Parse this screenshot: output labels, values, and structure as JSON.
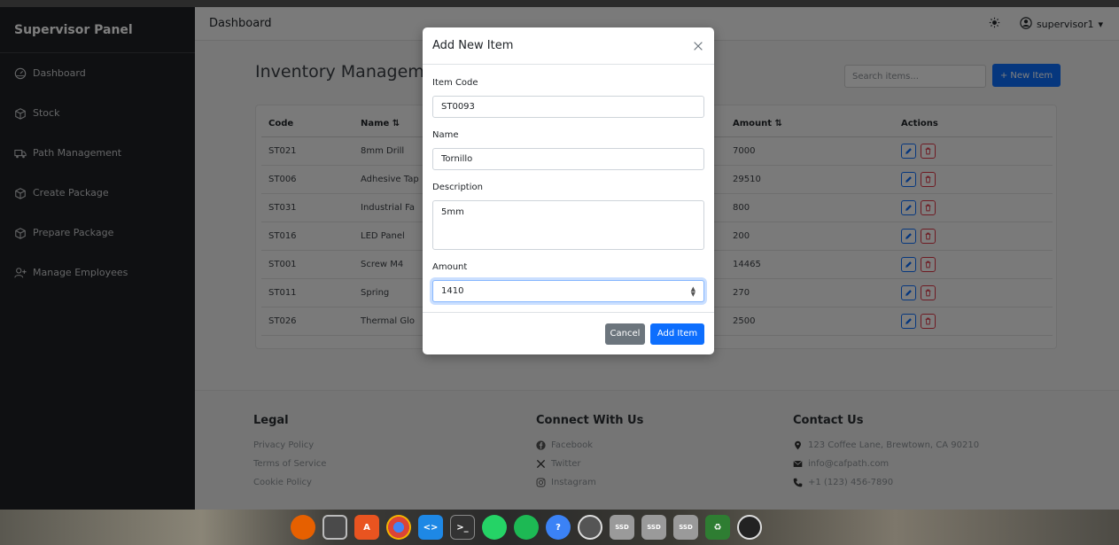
{
  "sidebar": {
    "title": "Supervisor Panel",
    "items": [
      {
        "label": "Dashboard",
        "icon": "speedometer-icon"
      },
      {
        "label": "Stock",
        "icon": "box-icon"
      },
      {
        "label": "Path Management",
        "icon": "truck-icon"
      },
      {
        "label": "Create Package",
        "icon": "box-icon"
      },
      {
        "label": "Prepare Package",
        "icon": "box-icon"
      },
      {
        "label": "Manage Employees",
        "icon": "user-plus-icon"
      }
    ]
  },
  "topbar": {
    "title": "Dashboard",
    "username": "supervisor1"
  },
  "page": {
    "title": "Inventory Managemen",
    "search_placeholder": "Search items...",
    "new_item_label": "+ New Item"
  },
  "table": {
    "headers": {
      "code": "Code",
      "name": "Name ⇅",
      "amount": "Amount ⇅",
      "actions": "Actions"
    },
    "rows": [
      {
        "code": "ST021",
        "name": "8mm Drill",
        "amount": "7000"
      },
      {
        "code": "ST006",
        "name": "Adhesive Tap",
        "amount": "29510"
      },
      {
        "code": "ST031",
        "name": "Industrial Fa",
        "amount": "800"
      },
      {
        "code": "ST016",
        "name": "LED Panel",
        "amount": "200"
      },
      {
        "code": "ST001",
        "name": "Screw M4",
        "amount": "14465"
      },
      {
        "code": "ST011",
        "name": "Spring",
        "amount": "270"
      },
      {
        "code": "ST026",
        "name": "Thermal Glo",
        "amount": "2500"
      }
    ]
  },
  "footer": {
    "legal": {
      "title": "Legal",
      "links": [
        "Privacy Policy",
        "Terms of Service",
        "Cookie Policy"
      ]
    },
    "connect": {
      "title": "Connect With Us",
      "links": [
        "Facebook",
        "Twitter",
        "Instagram"
      ]
    },
    "contact": {
      "title": "Contact Us",
      "address": "123 Coffee Lane, Brewtown, CA 90210",
      "email": "info@cafpath.com",
      "phone": "+1 (123) 456-7890"
    }
  },
  "modal": {
    "title": "Add New Item",
    "code_label": "Item Code",
    "code_value": "ST0093",
    "name_label": "Name",
    "name_value": "Tornillo",
    "description_label": "Description",
    "description_value": "5mm",
    "amount_label": "Amount",
    "amount_value": "1410",
    "cancel_label": "Cancel",
    "add_label": "Add Item"
  },
  "dock": {
    "ssd_label": "SSD"
  },
  "colors": {
    "sidebar_bg": "#1f2124",
    "primary": "#0d6efd",
    "danger": "#dc3545",
    "secondary": "#6c757d"
  }
}
